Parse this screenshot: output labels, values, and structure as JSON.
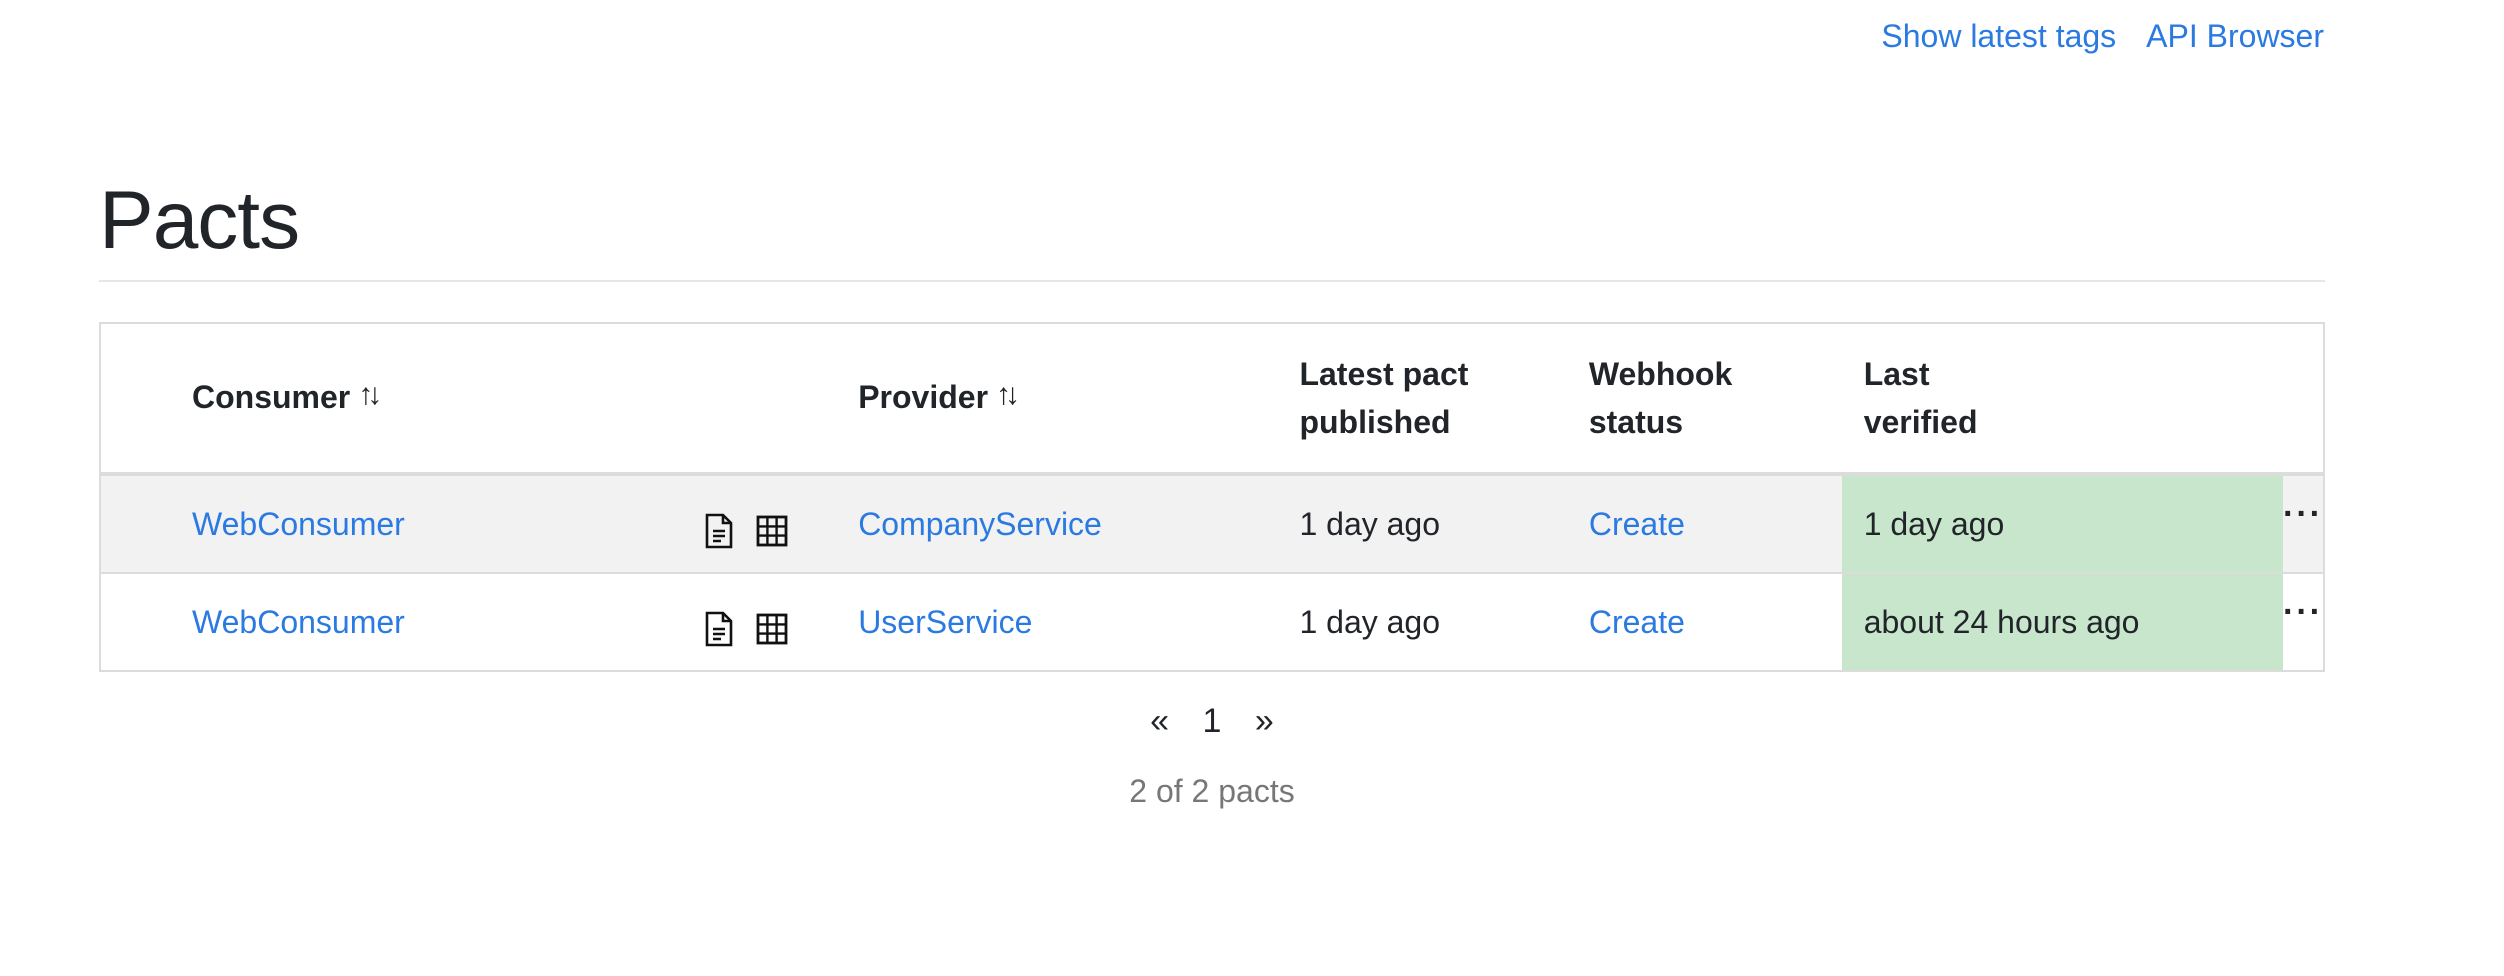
{
  "nav": {
    "show_latest_tags": "Show latest tags",
    "api_browser": "API Browser"
  },
  "page_title": "Pacts",
  "table": {
    "headers": {
      "consumer": "Consumer",
      "provider": "Provider",
      "latest_pact_published_line1": "Latest pact",
      "latest_pact_published_line2": "published",
      "webhook_status_line1": "Webhook",
      "webhook_status_line2": "status",
      "last_verified_line1": "Last",
      "last_verified_line2": "verified"
    },
    "rows": [
      {
        "consumer": "WebConsumer",
        "provider": "CompanyService",
        "latest_pact_published": "1 day ago",
        "webhook_status": "Create",
        "last_verified": "1 day ago"
      },
      {
        "consumer": "WebConsumer",
        "provider": "UserService",
        "latest_pact_published": "1 day ago",
        "webhook_status": "Create",
        "last_verified": "about 24 hours ago"
      }
    ]
  },
  "pagination": {
    "prev": "«",
    "current": "1",
    "next": "»"
  },
  "count_text": "2 of 2 pacts",
  "colors": {
    "link": "#2a7ae2",
    "verified_success_bg": "#c8e6cc",
    "striped_row_bg": "#f2f2f2"
  },
  "icons": {
    "sort": "sort-arrows-icon",
    "document": "document-icon",
    "matrix": "matrix-grid-icon",
    "more": "ellipsis-icon"
  }
}
